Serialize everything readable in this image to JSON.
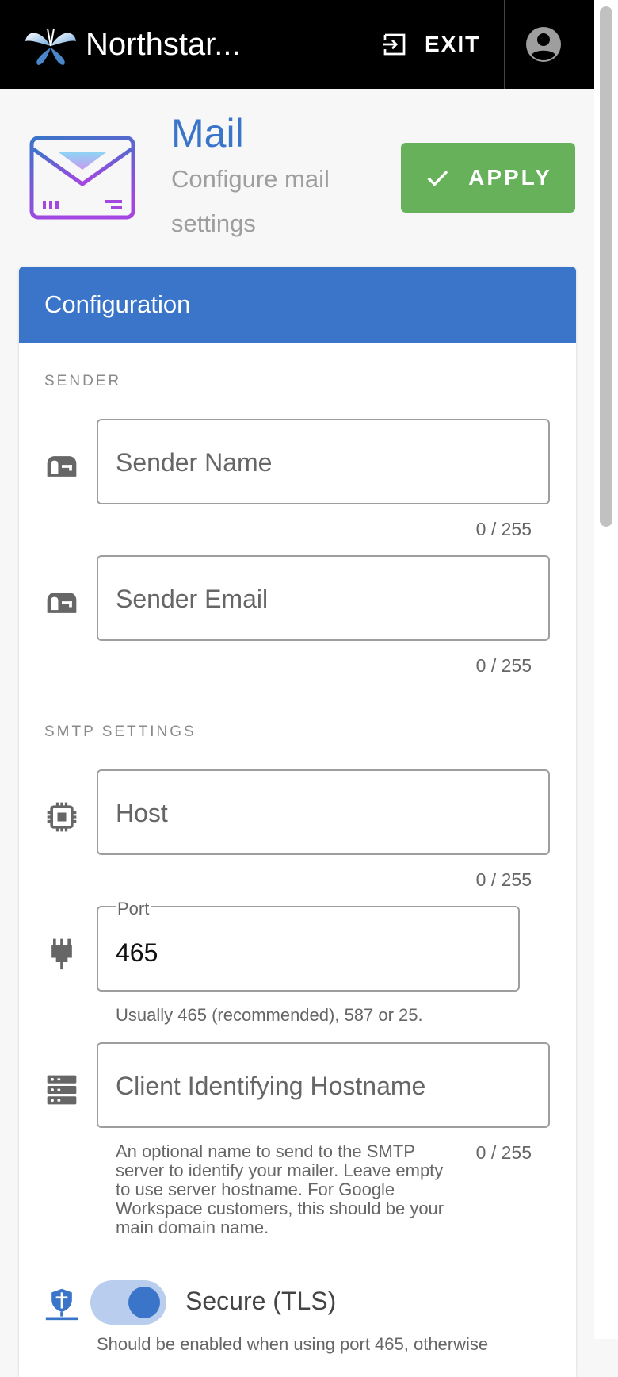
{
  "app": {
    "title": "Northstar..."
  },
  "topbar": {
    "exit_label": "EXIT"
  },
  "page": {
    "title": "Mail",
    "subtitle": "Configure mail settings",
    "apply_label": "APPLY"
  },
  "card": {
    "title": "Configuration"
  },
  "sender": {
    "section_label": "SENDER",
    "name_placeholder": "Sender Name",
    "name_counter": "0 / 255",
    "email_placeholder": "Sender Email",
    "email_counter": "0 / 255"
  },
  "smtp": {
    "section_label": "SMTP SETTINGS",
    "host_placeholder": "Host",
    "host_counter": "0 / 255",
    "port_label": "Port",
    "port_value": "465",
    "port_hint": "Usually 465 (recommended), 587 or 25.",
    "client_placeholder": "Client Identifying Hostname",
    "client_counter": "0 / 255",
    "client_hint": "An optional name to send to the SMTP server to identify your mailer. Leave empty to use server hostname. For Google Workspace customers, this should be your main domain name.",
    "secure_label": "Secure (TLS)",
    "secure_enabled": true,
    "secure_hint_partial": "Should be enabled when using port 465, otherwise"
  },
  "colors": {
    "primary": "#3a75c9",
    "apply": "#66b15a",
    "topbar": "#000000"
  },
  "icons": {
    "logo": "butterfly-logo",
    "exit": "exit-icon",
    "account": "account-circle-icon",
    "mail": "mail-envelope-icon",
    "apply": "check-icon",
    "sender_name": "mailbox-icon",
    "sender_email": "mailbox-icon",
    "host": "chip-icon",
    "port": "ethernet-port-icon",
    "client": "server-icon",
    "secure": "network-shield-icon"
  }
}
